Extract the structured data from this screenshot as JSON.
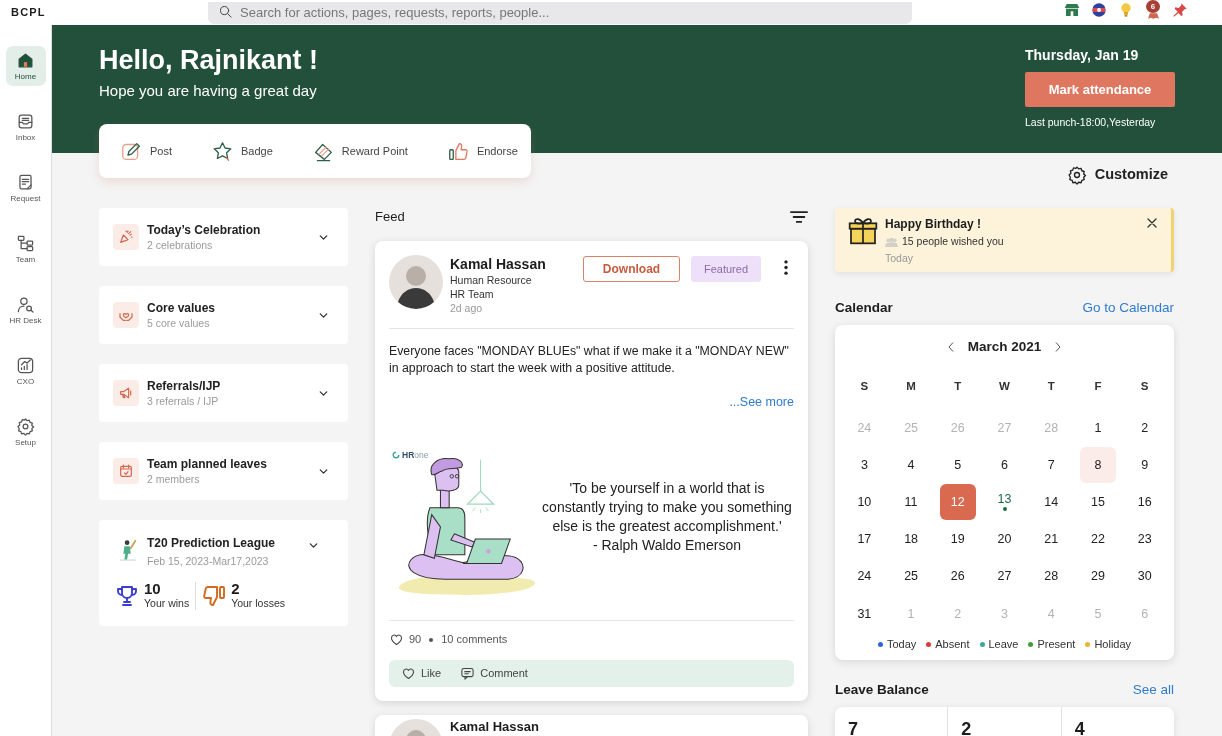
{
  "top_bar": {
    "brand": "BCPL",
    "search": {
      "placeholder": "Search for actions, pages, requests, reports, people..."
    },
    "notification_count": "6"
  },
  "sidebar": {
    "items": [
      {
        "label": "Home",
        "selected": true
      },
      {
        "label": "Inbox",
        "selected": false
      },
      {
        "label": "Request",
        "selected": false
      },
      {
        "label": "Team",
        "selected": false
      },
      {
        "label": "HR Desk",
        "selected": false
      },
      {
        "label": "CXO",
        "selected": false
      },
      {
        "label": "Setup",
        "selected": false
      }
    ]
  },
  "header": {
    "greeting": "Hello, Rajnikant !",
    "subtitle": "Hope you are having a great day",
    "date": "Thursday, Jan 19",
    "attendance_button": "Mark attendance",
    "last_punch": "Last punch-18:00,Yesterday"
  },
  "quick_actions": [
    "Post",
    "Badge",
    "Reward Point",
    "Endorse"
  ],
  "customize": "Customize",
  "widgets": [
    {
      "title": "Today’s Celebration",
      "subtitle": "2 celebrations"
    },
    {
      "title": "Core values",
      "subtitle": "5 core values"
    },
    {
      "title": "Referrals/IJP",
      "subtitle": "3 referrals / IJP"
    },
    {
      "title": "Team planned leaves",
      "subtitle": "2 members"
    }
  ],
  "league": {
    "title": "T20 Prediction League",
    "dates": "Feb 15, 2023-Mar17,2023",
    "stats": [
      {
        "value": "10",
        "label": "Your wins"
      },
      {
        "value": "2",
        "label": "Your losses"
      }
    ]
  },
  "feed": {
    "title": "Feed",
    "posts": [
      {
        "author": "Kamal Hassan",
        "role": "Human Resource",
        "team": "HR Team",
        "time": "2d ago",
        "download": "Download",
        "featured": "Featured",
        "text": "Everyone faces \"MONDAY BLUEs\" what if we make it a \"MONDAY NEW\" in approach to start the week with a positive attitude.",
        "see_more": "...See more",
        "image": {
          "logo": "**HR**one",
          "quote": "'To be yourself in a world that is constantly trying to make you something else is the greatest accomplishment.'",
          "attribution": "- Ralph Waldo Emerson"
        },
        "likes": "90",
        "comments": "10 comments",
        "actions": [
          "Like",
          "Comment"
        ]
      },
      {
        "author": "Kamal Hassan"
      }
    ]
  },
  "birthday": {
    "title": "Happy Birthday !",
    "wishes": "15 people wished you",
    "time": "Today"
  },
  "calendar": {
    "title": "Calendar",
    "link": "Go to Calendar",
    "month": "March 2021",
    "weekdays": [
      "S",
      "M",
      "T",
      "W",
      "T",
      "F",
      "S"
    ],
    "weeks": [
      [
        {
          "label": "24",
          "kind": "other",
          "selected": false,
          "highlighted": false
        },
        {
          "label": "25",
          "kind": "other",
          "selected": false,
          "highlighted": false
        },
        {
          "label": "26",
          "kind": "other",
          "selected": false,
          "highlighted": false
        },
        {
          "label": "27",
          "kind": "other",
          "selected": false,
          "highlighted": false
        },
        {
          "label": "28",
          "kind": "other",
          "selected": false,
          "highlighted": false
        },
        {
          "label": "1",
          "kind": "day",
          "selected": false,
          "highlighted": false
        },
        {
          "label": "2",
          "kind": "day",
          "selected": false,
          "highlighted": false
        }
      ],
      [
        {
          "label": "3",
          "kind": "day",
          "selected": false,
          "highlighted": false
        },
        {
          "label": "4",
          "kind": "day",
          "selected": false,
          "highlighted": false
        },
        {
          "label": "5",
          "kind": "day",
          "selected": false,
          "highlighted": false
        },
        {
          "label": "6",
          "kind": "day",
          "selected": false,
          "highlighted": false
        },
        {
          "label": "7",
          "kind": "day",
          "selected": false,
          "highlighted": false
        },
        {
          "label": "8",
          "kind": "day",
          "selected": false,
          "highlighted": true
        },
        {
          "label": "9",
          "kind": "day",
          "selected": false,
          "highlighted": false
        }
      ],
      [
        {
          "label": "10",
          "kind": "day",
          "selected": false,
          "highlighted": false
        },
        {
          "label": "11",
          "kind": "day",
          "selected": false,
          "highlighted": false
        },
        {
          "label": "12",
          "kind": "day",
          "selected": true,
          "highlighted": false
        },
        {
          "label": "13",
          "kind": "day",
          "selected": false,
          "highlighted": false,
          "color": "#1f6b45"
        },
        {
          "label": "14",
          "kind": "day",
          "selected": false,
          "highlighted": false
        },
        {
          "label": "15",
          "kind": "day",
          "selected": false,
          "highlighted": false
        },
        {
          "label": "16",
          "kind": "day",
          "selected": false,
          "highlighted": false
        }
      ],
      [
        {
          "label": "17",
          "kind": "day",
          "selected": false,
          "highlighted": false
        },
        {
          "label": "18",
          "kind": "day",
          "selected": false,
          "highlighted": false
        },
        {
          "label": "19",
          "kind": "day",
          "selected": false,
          "highlighted": false
        },
        {
          "label": "20",
          "kind": "day",
          "selected": false,
          "highlighted": false
        },
        {
          "label": "21",
          "kind": "day",
          "selected": false,
          "highlighted": false
        },
        {
          "label": "22",
          "kind": "day",
          "selected": false,
          "highlighted": false
        },
        {
          "label": "23",
          "kind": "day",
          "selected": false,
          "highlighted": false
        }
      ],
      [
        {
          "label": "24",
          "kind": "day",
          "selected": false,
          "highlighted": false
        },
        {
          "label": "25",
          "kind": "day",
          "selected": false,
          "highlighted": false
        },
        {
          "label": "26",
          "kind": "day",
          "selected": false,
          "highlighted": false
        },
        {
          "label": "27",
          "kind": "day",
          "selected": false,
          "highlighted": false
        },
        {
          "label": "28",
          "kind": "day",
          "selected": false,
          "highlighted": false
        },
        {
          "label": "29",
          "kind": "day",
          "selected": false,
          "highlighted": false
        },
        {
          "label": "30",
          "kind": "day",
          "selected": false,
          "highlighted": false
        }
      ],
      [
        {
          "label": "31",
          "kind": "day",
          "selected": false,
          "highlighted": false
        },
        {
          "label": "1",
          "kind": "other",
          "selected": false,
          "highlighted": false
        },
        {
          "label": "2",
          "kind": "other",
          "selected": false,
          "highlighted": false
        },
        {
          "label": "3",
          "kind": "other",
          "selected": false,
          "highlighted": false
        },
        {
          "label": "4",
          "kind": "other",
          "selected": false,
          "highlighted": false
        },
        {
          "label": "5",
          "kind": "other",
          "selected": false,
          "highlighted": false
        },
        {
          "label": "6",
          "kind": "other",
          "selected": false,
          "highlighted": false
        }
      ]
    ],
    "legend": [
      {
        "label": "Today",
        "color": "#2e63e0"
      },
      {
        "label": "Absent",
        "color": "#d93a3a"
      },
      {
        "label": "Leave",
        "color": "#3aa59a"
      },
      {
        "label": "Present",
        "color": "#3f9e35"
      },
      {
        "label": "Holiday",
        "color": "#f0b232"
      }
    ]
  },
  "leave_balance": {
    "title": "Leave Balance",
    "link": "See all",
    "values": [
      "7",
      "2",
      "4"
    ]
  }
}
